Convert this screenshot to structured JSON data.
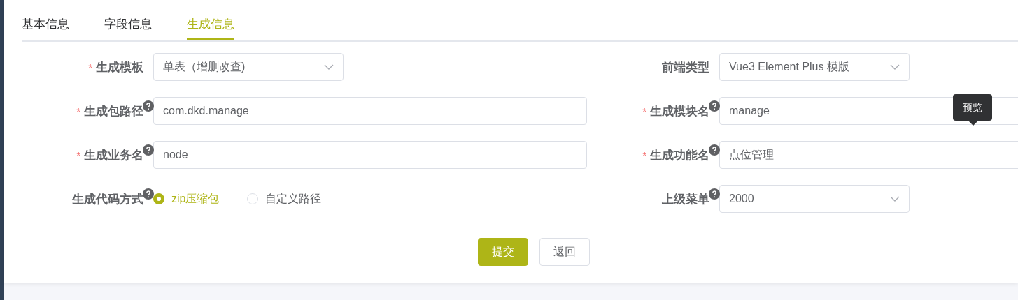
{
  "tabs": [
    {
      "label": "基本信息",
      "selected": false
    },
    {
      "label": "字段信息",
      "selected": false
    },
    {
      "label": "生成信息",
      "selected": true
    }
  ],
  "fields": [
    {
      "label": "生成模板",
      "required_mark": "*",
      "help": false,
      "kind": "select",
      "value": "单表（增删改查)"
    },
    {
      "label": "前端类型",
      "help": false,
      "kind": "select",
      "value": "Vue3 Element Plus 模版"
    },
    {
      "label": "生成包路径",
      "required_mark": "*",
      "help": true,
      "kind": "input",
      "value": "com.dkd.manage"
    },
    {
      "label": "生成模块名",
      "required_mark": "*",
      "help": true,
      "kind": "input",
      "value": "manage"
    },
    {
      "label": "生成业务名",
      "required_mark": "*",
      "help": true,
      "kind": "input",
      "value": "node"
    },
    {
      "label": "生成功能名",
      "required_mark": "*",
      "help": true,
      "kind": "input",
      "value": "点位管理"
    },
    {
      "label": "生成代码方式",
      "help": true,
      "kind": "radio",
      "options": [
        {
          "label": "zip压缩包",
          "selected": true
        },
        {
          "label": "自定义路径",
          "selected": false
        }
      ]
    },
    {
      "label": "上级菜单",
      "help": true,
      "kind": "select",
      "value": "2000"
    }
  ],
  "tooltip": {
    "text": "预览"
  },
  "buttons": [
    {
      "label": "提交",
      "kind": "primary"
    },
    {
      "label": "返回",
      "kind": "default"
    }
  ]
}
